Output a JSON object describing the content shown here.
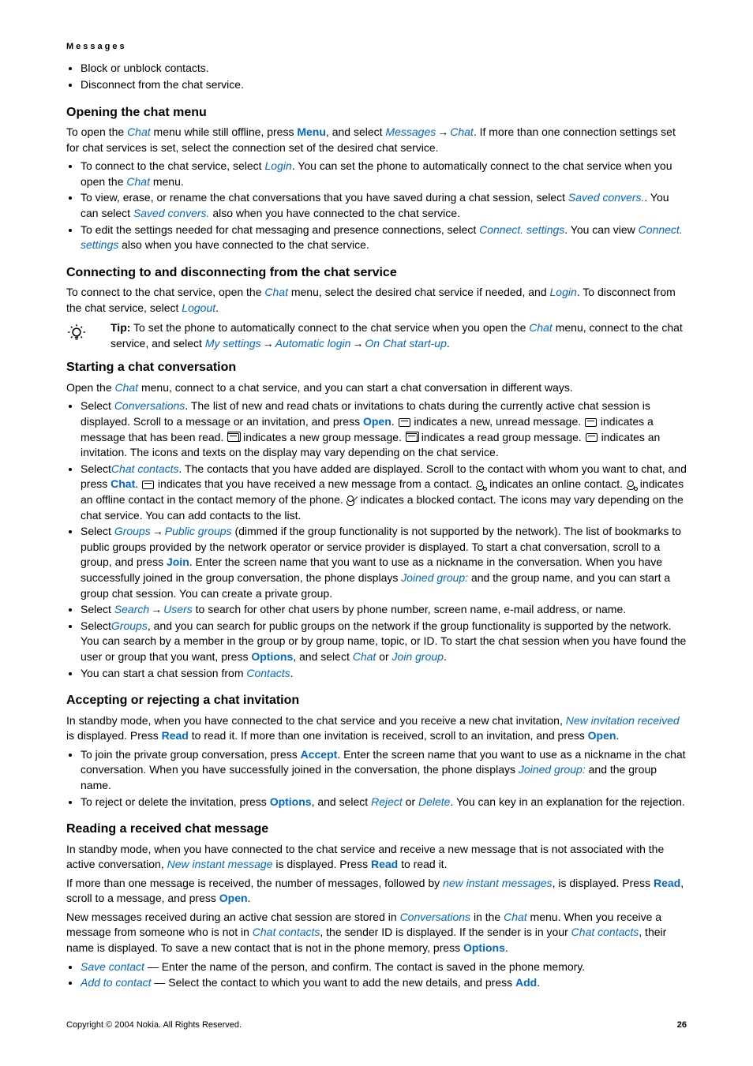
{
  "section_label": "Messages",
  "top_bullets": [
    "Block or unblock contacts.",
    "Disconnect from the chat service."
  ],
  "h_open": "Opening the chat menu",
  "open_p_parts": [
    "To open the ",
    "Chat",
    " menu while still offline, press ",
    "Menu",
    ", and select ",
    "Messages",
    " → ",
    "Chat",
    ". If more than one connection settings set for chat services is set, select the connection set of the desired chat service."
  ],
  "open_bullets": [
    {
      "parts": [
        "To connect to the chat service, select ",
        "Login",
        ". You can set the phone to automatically connect to the chat service when you open the ",
        "Chat",
        " menu."
      ]
    },
    {
      "parts": [
        "To view, erase, or rename the chat conversations that you have saved during a chat session, select ",
        "Saved convers.",
        ". You can select ",
        "Saved convers.",
        " also when you have connected to the chat service."
      ]
    },
    {
      "parts": [
        "To edit the settings needed for chat messaging and presence connections, select ",
        "Connect. settings",
        ". You can view ",
        "Connect. settings",
        " also when you have connected to the chat service."
      ]
    }
  ],
  "h_conn": "Connecting to and disconnecting from the chat service",
  "conn_p_parts": [
    "To connect to the chat service, open the ",
    "Chat",
    " menu, select the desired chat service if needed, and ",
    "Login",
    ". To disconnect from the chat service, select ",
    "Logout",
    "."
  ],
  "tip_label": "Tip:",
  "tip_parts": [
    " To set the phone to automatically connect to the chat service when you open the ",
    "Chat",
    " menu, connect to the chat service, and select ",
    "My settings",
    " → ",
    "Automatic login",
    " → ",
    "On Chat start-up",
    "."
  ],
  "h_start": "Starting a chat conversation",
  "start_p_parts": [
    "Open the ",
    "Chat",
    " menu, connect to a chat service, and you can start a chat conversation in different ways."
  ],
  "start_bullets": {
    "b1": [
      "Select ",
      "Conversations",
      ". The list of new and read chats or invitations to chats during the currently active chat session is displayed. Scroll to a message or an invitation, and press ",
      "Open",
      ". ",
      " indicates a new, unread message. ",
      " indicates a message that has been read. ",
      " indicates a new group message. ",
      " indicates a read group message. ",
      " indicates an invitation. The icons and texts on the display may vary depending on the chat service."
    ],
    "b2": [
      " Select",
      "Chat contacts",
      ". The contacts that you have added are displayed. Scroll to the contact with whom you want to chat, and press ",
      "Chat",
      ". ",
      " indicates that you have received a new message from a contact. ",
      " indicates an online contact. ",
      " indicates an offline contact in the contact memory of the phone. ",
      " indicates a blocked contact. The icons may vary depending on the chat service. You can add contacts to the list."
    ],
    "b3": [
      "Select ",
      "Groups",
      " → ",
      "Public groups",
      " (dimmed if the group functionality is not supported by the network). The list of bookmarks to public groups provided by the network operator or service provider is displayed. To start a chat conversation, scroll to a group, and press ",
      "Join",
      ". Enter the screen name that you want to use as a nickname in the conversation. When you have successfully joined in the group conversation, the phone displays ",
      "Joined group:",
      " and the group name, and you can start a group chat session. You can create a private group."
    ],
    "b4": [
      "Select ",
      "Search",
      " → ",
      "Users",
      " to search for other chat users by phone number, screen name, e-mail address, or name."
    ],
    "b5": [
      "Select",
      "Groups",
      ", and you can search for public groups on the network if the group functionality is supported by the network. You can search by a member in the group or by group name, topic, or ID. To start the chat session when you have found the user or group that you want, press ",
      "Options",
      ", and select ",
      "Chat",
      " or ",
      "Join group",
      "."
    ],
    "b6": [
      "You can start a chat session from ",
      "Contacts",
      "."
    ]
  },
  "h_accept": "Accepting or rejecting a chat invitation",
  "accept_p_parts": [
    "In standby mode, when you have connected to the chat service and you receive a new chat invitation, ",
    "New invitation received",
    " is displayed. Press ",
    "Read",
    " to read it. If more than one invitation is received, scroll to an invitation, and press ",
    "Open",
    "."
  ],
  "accept_bullets": {
    "b1": [
      "To join the private group conversation, press ",
      "Accept",
      ". Enter the screen name that you want to use as a nickname in the chat conversation. When you have successfully joined in the conversation, the phone displays ",
      "Joined group:",
      " and the group name."
    ],
    "b2": [
      "To reject or delete the invitation, press ",
      "Options",
      ", and select ",
      "Reject",
      " or ",
      "Delete",
      ". You can key in an explanation for the rejection."
    ]
  },
  "h_read": "Reading a received chat message",
  "read_p1": [
    "In standby mode, when you have connected to the chat service and receive a new message that is not associated with the active conversation, ",
    "New instant message",
    " is displayed. Press ",
    "Read",
    " to read it."
  ],
  "read_p2": [
    "If more than one message is received, the number of messages, followed by ",
    "new instant messages",
    ", is displayed. Press ",
    "Read",
    ", scroll to a message, and press ",
    "Open",
    "."
  ],
  "read_p3": [
    "New messages received during an active chat session are stored in ",
    "Conversations",
    " in the ",
    "Chat",
    " menu. When you receive a message from someone who is not in ",
    "Chat contacts",
    ", the sender ID is displayed. If the sender is in your ",
    "Chat contacts",
    ", their name is displayed. To save a new contact that is not in the phone memory, press ",
    "Options",
    "."
  ],
  "read_bullets": {
    "b1": [
      "Save contact",
      " — Enter the name of the person, and confirm. The contact is saved in the phone memory."
    ],
    "b2": [
      "Add to contact",
      "  — Select the contact to which you want to add the new details, and press ",
      "Add",
      "."
    ]
  },
  "footer": {
    "copyright": "Copyright © 2004 Nokia. All Rights Reserved.",
    "page": "26"
  }
}
